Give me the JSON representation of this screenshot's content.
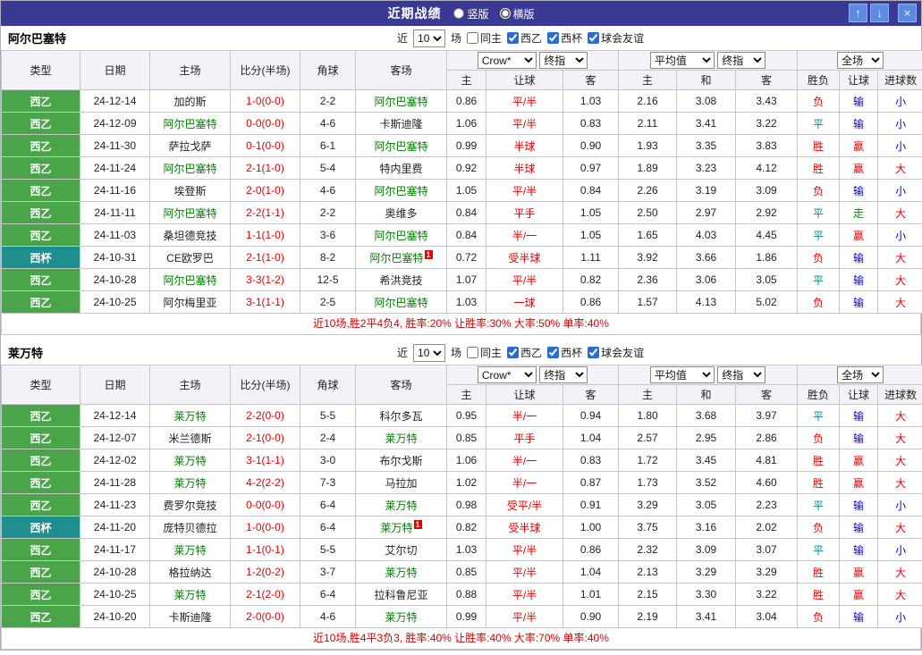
{
  "titlebar": {
    "title": "近期战绩",
    "layout_options": [
      {
        "label": "竖版",
        "selected": false
      },
      {
        "label": "横版",
        "selected": true
      }
    ],
    "buttons": {
      "up": "↑",
      "down": "↓",
      "close": "×"
    }
  },
  "filter": {
    "prefix": "近",
    "count": "10",
    "suffix": "场",
    "checkboxes": [
      {
        "label": "同主",
        "checked": false
      },
      {
        "label": "西乙",
        "checked": true
      },
      {
        "label": "西杯",
        "checked": true
      },
      {
        "label": "球会友谊",
        "checked": true
      }
    ]
  },
  "table_header": {
    "static_cols": [
      "类型",
      "日期",
      "主场",
      "比分(半场)",
      "角球",
      "客场"
    ],
    "bookmaker": "Crow*",
    "stage": "终指",
    "average": "平均值",
    "stage2": "终指",
    "scope": "全场",
    "odds_cols": [
      "主",
      "让球",
      "客"
    ],
    "avg_cols": [
      "主",
      "和",
      "客"
    ],
    "result_cols": [
      "胜负",
      "让球",
      "进球数"
    ]
  },
  "sections": [
    {
      "team": "阿尔巴塞特",
      "rows": [
        {
          "type": "西乙",
          "date": "24-12-14",
          "home": "加的斯",
          "score": "1-0(0-0)",
          "corner": "2-2",
          "away": "阿尔巴塞特",
          "o1": "0.86",
          "hcp": "平/半",
          "o2": "1.03",
          "a1": "2.16",
          "a2": "3.08",
          "a3": "3.43",
          "r1": "负",
          "r2": "输",
          "r3": "小"
        },
        {
          "type": "西乙",
          "date": "24-12-09",
          "home": "阿尔巴塞特",
          "score": "0-0(0-0)",
          "corner": "4-6",
          "away": "卡斯迪隆",
          "o1": "1.06",
          "hcp": "平/半",
          "o2": "0.83",
          "a1": "2.11",
          "a2": "3.41",
          "a3": "3.22",
          "r1": "平",
          "r2": "输",
          "r3": "小"
        },
        {
          "type": "西乙",
          "date": "24-11-30",
          "home": "萨拉戈萨",
          "score": "0-1(0-0)",
          "corner": "6-1",
          "away": "阿尔巴塞特",
          "o1": "0.99",
          "hcp": "半球",
          "o2": "0.90",
          "a1": "1.93",
          "a2": "3.35",
          "a3": "3.83",
          "r1": "胜",
          "r2": "赢",
          "r3": "小"
        },
        {
          "type": "西乙",
          "date": "24-11-24",
          "home": "阿尔巴塞特",
          "score": "2-1(1-0)",
          "corner": "5-4",
          "away": "特内里费",
          "o1": "0.92",
          "hcp": "半球",
          "o2": "0.97",
          "a1": "1.89",
          "a2": "3.23",
          "a3": "4.12",
          "r1": "胜",
          "r2": "赢",
          "r3": "大"
        },
        {
          "type": "西乙",
          "date": "24-11-16",
          "home": "埃登斯",
          "score": "2-0(1-0)",
          "corner": "4-6",
          "away": "阿尔巴塞特",
          "o1": "1.05",
          "hcp": "平/半",
          "o2": "0.84",
          "a1": "2.26",
          "a2": "3.19",
          "a3": "3.09",
          "r1": "负",
          "r2": "输",
          "r3": "小"
        },
        {
          "type": "西乙",
          "date": "24-11-11",
          "home": "阿尔巴塞特",
          "score": "2-2(1-1)",
          "corner": "2-2",
          "away": "奥维多",
          "o1": "0.84",
          "hcp": "平手",
          "o2": "1.05",
          "a1": "2.50",
          "a2": "2.97",
          "a3": "2.92",
          "r1": "平",
          "r2": "走",
          "r3": "大"
        },
        {
          "type": "西乙",
          "date": "24-11-03",
          "home": "桑坦德竞技",
          "score": "1-1(1-0)",
          "corner": "3-6",
          "away": "阿尔巴塞特",
          "o1": "0.84",
          "hcp": "半/一",
          "o2": "1.05",
          "a1": "1.65",
          "a2": "4.03",
          "a3": "4.45",
          "r1": "平",
          "r2": "赢",
          "r3": "小"
        },
        {
          "type": "西杯",
          "date": "24-10-31",
          "home": "CE欧罗巴",
          "score": "2-1(1-0)",
          "corner": "8-2",
          "away": "阿尔巴塞特",
          "away_badge": "1",
          "o1": "0.72",
          "hcp": "受半球",
          "o2": "1.11",
          "a1": "3.92",
          "a2": "3.66",
          "a3": "1.86",
          "r1": "负",
          "r2": "输",
          "r3": "大"
        },
        {
          "type": "西乙",
          "date": "24-10-28",
          "home": "阿尔巴塞特",
          "score": "3-3(1-2)",
          "corner": "12-5",
          "away": "希洪竞技",
          "o1": "1.07",
          "hcp": "平/半",
          "o2": "0.82",
          "a1": "2.36",
          "a2": "3.06",
          "a3": "3.05",
          "r1": "平",
          "r2": "输",
          "r3": "大"
        },
        {
          "type": "西乙",
          "date": "24-10-25",
          "home": "阿尔梅里亚",
          "score": "3-1(1-1)",
          "corner": "2-5",
          "away": "阿尔巴塞特",
          "o1": "1.03",
          "hcp": "一球",
          "o2": "0.86",
          "a1": "1.57",
          "a2": "4.13",
          "a3": "5.02",
          "r1": "负",
          "r2": "输",
          "r3": "大"
        }
      ],
      "summary": "近10场,胜2平4负4, 胜率:20% 让胜率:30% 大率:50% 单率:40%"
    },
    {
      "team": "莱万特",
      "rows": [
        {
          "type": "西乙",
          "date": "24-12-14",
          "home": "莱万特",
          "score": "2-2(0-0)",
          "corner": "5-5",
          "away": "科尔多瓦",
          "o1": "0.95",
          "hcp": "半/一",
          "o2": "0.94",
          "a1": "1.80",
          "a2": "3.68",
          "a3": "3.97",
          "r1": "平",
          "r2": "输",
          "r3": "大"
        },
        {
          "type": "西乙",
          "date": "24-12-07",
          "home": "米兰德斯",
          "score": "2-1(0-0)",
          "corner": "2-4",
          "away": "莱万特",
          "o1": "0.85",
          "hcp": "平手",
          "o2": "1.04",
          "a1": "2.57",
          "a2": "2.95",
          "a3": "2.86",
          "r1": "负",
          "r2": "输",
          "r3": "大"
        },
        {
          "type": "西乙",
          "date": "24-12-02",
          "home": "莱万特",
          "score": "3-1(1-1)",
          "corner": "3-0",
          "away": "布尔戈斯",
          "o1": "1.06",
          "hcp": "半/一",
          "o2": "0.83",
          "a1": "1.72",
          "a2": "3.45",
          "a3": "4.81",
          "r1": "胜",
          "r2": "赢",
          "r3": "大"
        },
        {
          "type": "西乙",
          "date": "24-11-28",
          "home": "莱万特",
          "score": "4-2(2-2)",
          "corner": "7-3",
          "away": "马拉加",
          "o1": "1.02",
          "hcp": "半/一",
          "o2": "0.87",
          "a1": "1.73",
          "a2": "3.52",
          "a3": "4.60",
          "r1": "胜",
          "r2": "赢",
          "r3": "大"
        },
        {
          "type": "西乙",
          "date": "24-11-23",
          "home": "费罗尔竞技",
          "score": "0-0(0-0)",
          "corner": "6-4",
          "away": "莱万特",
          "o1": "0.98",
          "hcp": "受平/半",
          "o2": "0.91",
          "a1": "3.29",
          "a2": "3.05",
          "a3": "2.23",
          "r1": "平",
          "r2": "输",
          "r3": "小"
        },
        {
          "type": "西杯",
          "date": "24-11-20",
          "home": "庞特贝德拉",
          "score": "1-0(0-0)",
          "corner": "6-4",
          "away": "莱万特",
          "away_badge": "1",
          "o1": "0.82",
          "hcp": "受半球",
          "o2": "1.00",
          "a1": "3.75",
          "a2": "3.16",
          "a3": "2.02",
          "r1": "负",
          "r2": "输",
          "r3": "大"
        },
        {
          "type": "西乙",
          "date": "24-11-17",
          "home": "莱万特",
          "score": "1-1(0-1)",
          "corner": "5-5",
          "away": "艾尔切",
          "o1": "1.03",
          "hcp": "平/半",
          "o2": "0.86",
          "a1": "2.32",
          "a2": "3.09",
          "a3": "3.07",
          "r1": "平",
          "r2": "输",
          "r3": "小"
        },
        {
          "type": "西乙",
          "date": "24-10-28",
          "home": "格拉纳达",
          "score": "1-2(0-2)",
          "corner": "3-7",
          "away": "莱万特",
          "o1": "0.85",
          "hcp": "平/半",
          "o2": "1.04",
          "a1": "2.13",
          "a2": "3.29",
          "a3": "3.29",
          "r1": "胜",
          "r2": "赢",
          "r3": "大"
        },
        {
          "type": "西乙",
          "date": "24-10-25",
          "home": "莱万特",
          "score": "2-1(2-0)",
          "corner": "6-4",
          "away": "拉科鲁尼亚",
          "o1": "0.88",
          "hcp": "平/半",
          "o2": "1.01",
          "a1": "2.15",
          "a2": "3.30",
          "a3": "3.22",
          "r1": "胜",
          "r2": "赢",
          "r3": "大"
        },
        {
          "type": "西乙",
          "date": "24-10-20",
          "home": "卡斯迪隆",
          "score": "2-0(0-0)",
          "corner": "4-6",
          "away": "莱万特",
          "o1": "0.99",
          "hcp": "平/半",
          "o2": "0.90",
          "a1": "2.19",
          "a2": "3.41",
          "a3": "3.04",
          "r1": "负",
          "r2": "输",
          "r3": "小"
        }
      ],
      "summary": "近10场,胜4平3负3, 胜率:40% 让胜率:40% 大率:70% 单率:40%"
    }
  ],
  "colors": {
    "titlebar_bg": "#3a3a94",
    "button_blue": "#5b8ae0",
    "league_green": "#4aa54a",
    "cup_teal": "#1f8e8e",
    "focus_team_green": "#008000",
    "score_red": "#e60000",
    "win_red": "#e60000",
    "lose_blue": "#0000dd",
    "draw_teal": "#008b8b",
    "push_green": "#009000",
    "summary_red": "#d40000"
  }
}
